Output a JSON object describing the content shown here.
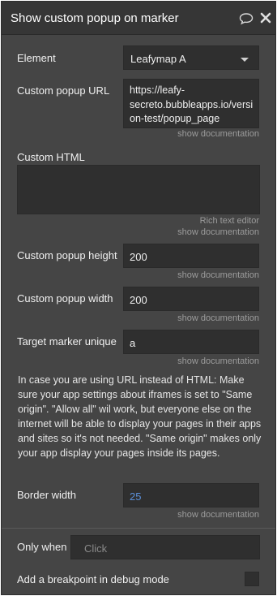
{
  "panel": {
    "title": "Show custom popup on marker",
    "icons": [
      "comment-icon",
      "close-icon"
    ]
  },
  "fields": {
    "element": {
      "label": "Element",
      "value": "Leafymap A"
    },
    "popup_url": {
      "label": "Custom popup URL",
      "value_lines": [
        "https://leafy-",
        "secreto.bubbleapps.io/versi",
        "on-test/popup_page"
      ],
      "docs": "show documentation"
    },
    "custom_html": {
      "label": "Custom HTML",
      "value": "",
      "rich_text": "Rich text editor",
      "docs": "show documentation"
    },
    "popup_height": {
      "label": "Custom popup height",
      "value": "200",
      "docs": "show documentation"
    },
    "popup_width": {
      "label": "Custom popup width",
      "value": "200",
      "docs": "show documentation"
    },
    "target_marker": {
      "label": "Target marker unique",
      "value": "a",
      "docs": "show documentation"
    },
    "note": "In case you are using URL instead of HTML: Make sure your app settings about iframes is set to \"Same origin\". \"Allow all\" wil work, but everyone else on the internet will be able to display your pages in their apps and sites so it's not needed. \"Same origin\" makes only your app display your pages inside its pages.",
    "border_width": {
      "label": "Border width",
      "value": "25",
      "docs": "show documentation"
    },
    "only_when": {
      "label": "Only when",
      "placeholder": "Click"
    },
    "breakpoint": {
      "label": "Add a breakpoint in debug mode",
      "checked": false
    }
  },
  "colors": {
    "accent_value": "#5b8fd8"
  }
}
